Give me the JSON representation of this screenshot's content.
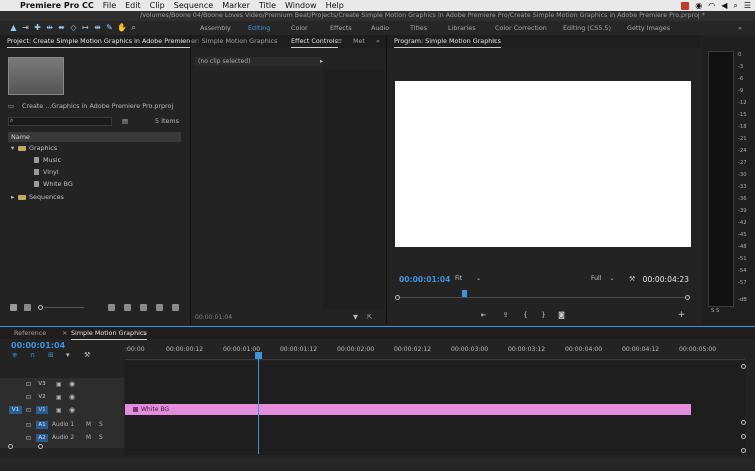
{
  "menubar": {
    "apple": "",
    "app_name": "Premiere Pro CC",
    "items": [
      "File",
      "Edit",
      "Clip",
      "Sequence",
      "Marker",
      "Title",
      "Window",
      "Help"
    ]
  },
  "path_title": "/Volumes/Boone 04/Boone Loves Video/Premium Beat/Projects/Create Simple Motion Graphics in Adobe Premiere Pro/Create Simple Motion Graphics in Adobe Premiere Pro.prproj *",
  "workspaces": [
    "Assembly",
    "Editing",
    "Color",
    "Effects",
    "Audio",
    "Titles",
    "Libraries",
    "Color Correction",
    "Editing (CS5.5)",
    "Getty Images"
  ],
  "active_workspace": "Editing",
  "project": {
    "tab_label": "Project: Create Simple Motion Graphics in Adobe Premiere",
    "file_name": "Create ...Graphics in Adobe Premiere Pro.prproj",
    "item_count": "5 Items",
    "column_name": "Name",
    "tree": [
      {
        "label": "Graphics",
        "type": "folder",
        "indent": 0,
        "expanded": true
      },
      {
        "label": "Music",
        "type": "file",
        "indent": 1
      },
      {
        "label": "Vinyl",
        "type": "file",
        "indent": 1
      },
      {
        "label": "White BG",
        "type": "file",
        "indent": 1
      },
      {
        "label": "Sequences",
        "type": "folder",
        "indent": 0,
        "expanded": false
      }
    ]
  },
  "effects": {
    "tab_source": "er: Simple Motion Graphics",
    "tab_effect_controls": "Effect Controls",
    "tab_meta": "Met",
    "no_clip": "(no clip selected)",
    "timecode": "00:00:01:04"
  },
  "program": {
    "tab_label": "Program: Simple Motion Graphics",
    "timecode_current": "00:00:01:04",
    "fit_label": "Fit",
    "quality_label": "Full",
    "timecode_duration": "00:00:04:23"
  },
  "meters": {
    "ticks": [
      "0",
      "-3",
      "-6",
      "-9",
      "-12",
      "-15",
      "-18",
      "-21",
      "-24",
      "-27",
      "-30",
      "-33",
      "-36",
      "-39",
      "-42",
      "-45",
      "-48",
      "-51",
      "-54",
      "-57",
      "-dB"
    ],
    "solo_labels": "S  S"
  },
  "timeline": {
    "tab_reference": "Reference",
    "tab_sequence": "Simple Motion Graphics",
    "timecode": "00:00:01:04",
    "ruler_labels": [
      ":00:00",
      "00:00:00:12",
      "00:00:01:00",
      "00:00:01:12",
      "00:00:02:00",
      "00:00:02:12",
      "00:00:03:00",
      "00:00:03:12",
      "00:00:04:00",
      "00:00:04:12",
      "00:00:05:00"
    ],
    "tracks": [
      {
        "id": "V3",
        "kind": "video",
        "source": ""
      },
      {
        "id": "V2",
        "kind": "video",
        "source": ""
      },
      {
        "id": "V1",
        "kind": "video",
        "source": "V1"
      },
      {
        "id": "A1",
        "kind": "audio",
        "source": "A1",
        "name": "Audio 1"
      },
      {
        "id": "A2",
        "kind": "audio",
        "source": "A2",
        "name": "Audio 2"
      }
    ],
    "clip_label": "White BG",
    "mute_label": "M",
    "solo_label": "S"
  },
  "colors": {
    "accent_blue": "#3e93de",
    "clip_pink": "#e58ddd",
    "folder_gold": "#c7a766"
  }
}
